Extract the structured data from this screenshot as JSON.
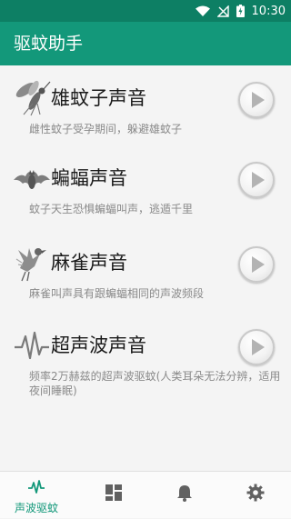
{
  "statusbar": {
    "time": "10:30"
  },
  "app": {
    "title": "驱蚊助手"
  },
  "items": [
    {
      "title": "雄蚊子声音",
      "desc": "雌性蚊子受孕期间，躲避雄蚊子"
    },
    {
      "title": "蝙蝠声音",
      "desc": "蚊子天生恐惧蝙蝠叫声，逃遁千里"
    },
    {
      "title": "麻雀声音",
      "desc": "麻雀叫声具有跟蝙蝠相同的声波频段"
    },
    {
      "title": "超声波声音",
      "desc": "频率2万赫兹的超声波驱蚊(人类耳朵无法分辨，适用夜间睡眠)"
    }
  ],
  "nav": {
    "tabs": [
      {
        "label": "声波驱蚊",
        "icon": "waveform-icon",
        "active": true
      },
      {
        "label": "",
        "icon": "dashboard-icon",
        "active": false
      },
      {
        "label": "",
        "icon": "bell-icon",
        "active": false
      },
      {
        "label": "",
        "icon": "gear-icon",
        "active": false
      }
    ]
  },
  "colors": {
    "primary": "#13987a",
    "status_bar": "#0d7f64",
    "active_tab": "#13987a"
  }
}
